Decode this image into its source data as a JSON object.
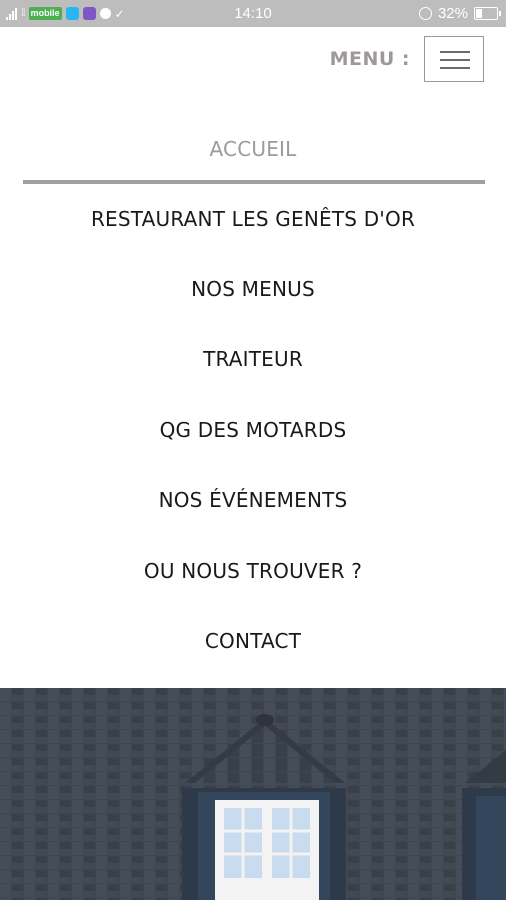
{
  "status_bar": {
    "carrier_badge": "mobile",
    "time": "14:10",
    "battery": "32%",
    "icons": [
      "signal-icon",
      "wifi-icon",
      "app-icon",
      "alarm-icon",
      "battery-icon"
    ]
  },
  "header": {
    "menu_label": "MENU :",
    "menu_icon": "hamburger-icon"
  },
  "nav": {
    "items": [
      {
        "label": "ACCUEIL",
        "active": true
      },
      {
        "label": "RESTAURANT LES GENÊTS D'OR"
      },
      {
        "label": "NOS MENUS"
      },
      {
        "label": "TRAITEUR"
      },
      {
        "label": "QG DES MOTARDS"
      },
      {
        "label": "NOS ÉVÉNEMENTS"
      },
      {
        "label": "OU NOUS TROUVER ?"
      },
      {
        "label": "CONTACT"
      }
    ]
  },
  "colors": {
    "active_nav": "#9b9b9b",
    "nav_text": "#1a1a1a",
    "divider": "#a59ea0",
    "status_bar": "#bdbdbd"
  }
}
